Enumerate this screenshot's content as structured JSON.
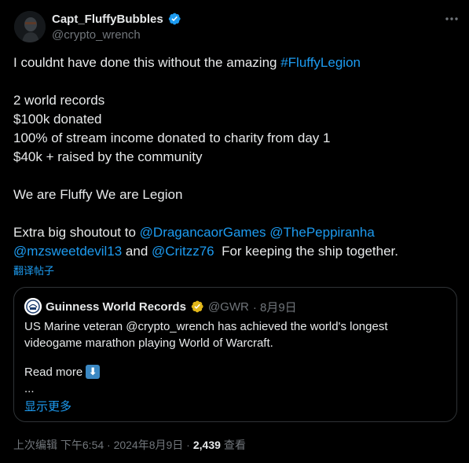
{
  "author": {
    "display_name": "Capt_FluffyBubbles",
    "handle": "@crypto_wrench",
    "verified": true
  },
  "more_icon": "more-horizontal-icon",
  "tweet": {
    "line1_text": "I couldnt have done this without the amazing ",
    "line1_hashtag": "#FluffyLegion",
    "line2": "2 world records",
    "line3": "$100k donated",
    "line4": "100% of stream income donated to charity from day 1",
    "line5": "$40k + raised by the community",
    "line6": "We are Fluffy We are Legion",
    "line7_text": "Extra big shoutout to ",
    "line7_mention1": "@DragancaorGames",
    "line7_mention2": "@ThePeppiranha",
    "line8_mention1": "@mzsweetdevil13",
    "line8_and": " and ",
    "line8_mention2": "@Critzz76",
    "line8_text": "  For keeping the ship together."
  },
  "translate_label": "翻译帖子",
  "quote": {
    "display_name": "Guinness World Records",
    "handle": "@GWR",
    "date": "· 8月9日",
    "line1": "US Marine veteran @crypto_wrench has achieved the world's longest",
    "line2": "videogame marathon playing World of Warcraft.",
    "read_more": "Read more",
    "ellipsis": "...",
    "show_more": "显示更多"
  },
  "footer": {
    "edited_time": "上次编辑 下午6:54 · 2024年8月9日 ·",
    "views_count": "2,439",
    "views_label": "查看"
  },
  "colors": {
    "background": "#000000",
    "text": "#e7e9ea",
    "muted": "#71767b",
    "link": "#1d9bf0",
    "verified_blue": "#1d9bf0",
    "verified_gold": "#e2b719",
    "border": "#2f3336"
  }
}
